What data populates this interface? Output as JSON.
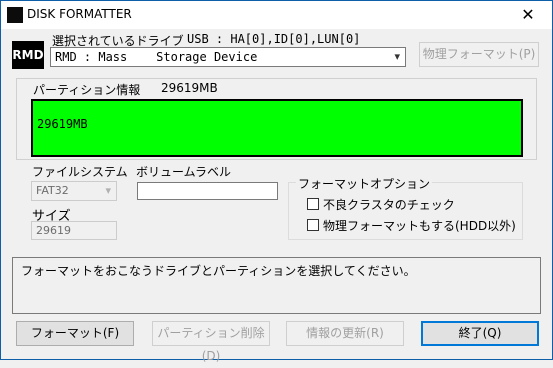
{
  "window": {
    "title": "DISK FORMATTER",
    "close_glyph": "✕"
  },
  "drive": {
    "logo_text": "RMD",
    "selected_label": "選択されているドライブ",
    "selected_address": "USB : HA[0],ID[0],LUN[0]",
    "combo_value": "RMD : Mass    Storage Device",
    "physical_format_button": "物理フォーマット(P)"
  },
  "partition": {
    "label": "パーティション情報",
    "total": "29619MB",
    "bar_text": "29619MB",
    "bar_color": "#00ff00"
  },
  "filesystem": {
    "label": "ファイルシステム",
    "value": "FAT32"
  },
  "volume": {
    "label": "ボリュームラベル",
    "value": ""
  },
  "size": {
    "label": "サイズ",
    "value": "29619"
  },
  "format_options": {
    "title": "フォーマットオプション",
    "bad_cluster_check": "不良クラスタのチェック",
    "physical_format_non_hdd": "物理フォーマットもする(HDD以外)"
  },
  "message": "フォーマットをおこなうドライブとパーティションを選択してください。",
  "buttons": {
    "format": "フォーマット(F)",
    "delete_partition": "パーティション削除(D)",
    "refresh_info": "情報の更新(R)",
    "exit": "終了(Q)"
  }
}
